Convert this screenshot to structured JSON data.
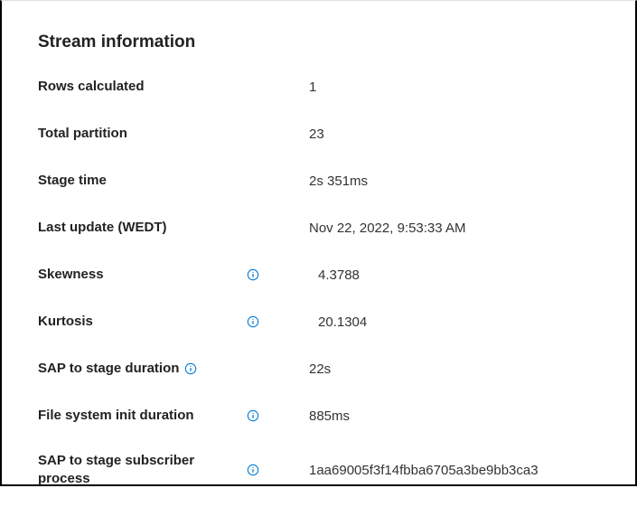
{
  "section_title": "Stream information",
  "rows": {
    "rows_calculated": {
      "label": "Rows calculated",
      "value": "1"
    },
    "total_partition": {
      "label": "Total partition",
      "value": "23"
    },
    "stage_time": {
      "label": "Stage time",
      "value": "2s 351ms"
    },
    "last_update": {
      "label": "Last update (WEDT)",
      "value": "Nov 22, 2022, 9:53:33 AM"
    },
    "skewness": {
      "label": "Skewness",
      "value": "4.3788"
    },
    "kurtosis": {
      "label": "Kurtosis",
      "value": "20.1304"
    },
    "sap_to_stage_duration": {
      "label": "SAP to stage duration",
      "value": "22s"
    },
    "file_system_init_duration": {
      "label": "File system init duration",
      "value": "885ms"
    },
    "sap_to_stage_subscriber_process": {
      "label": "SAP to stage subscriber process",
      "value": "1aa69005f3f14fbba6705a3be9bb3ca3"
    }
  }
}
